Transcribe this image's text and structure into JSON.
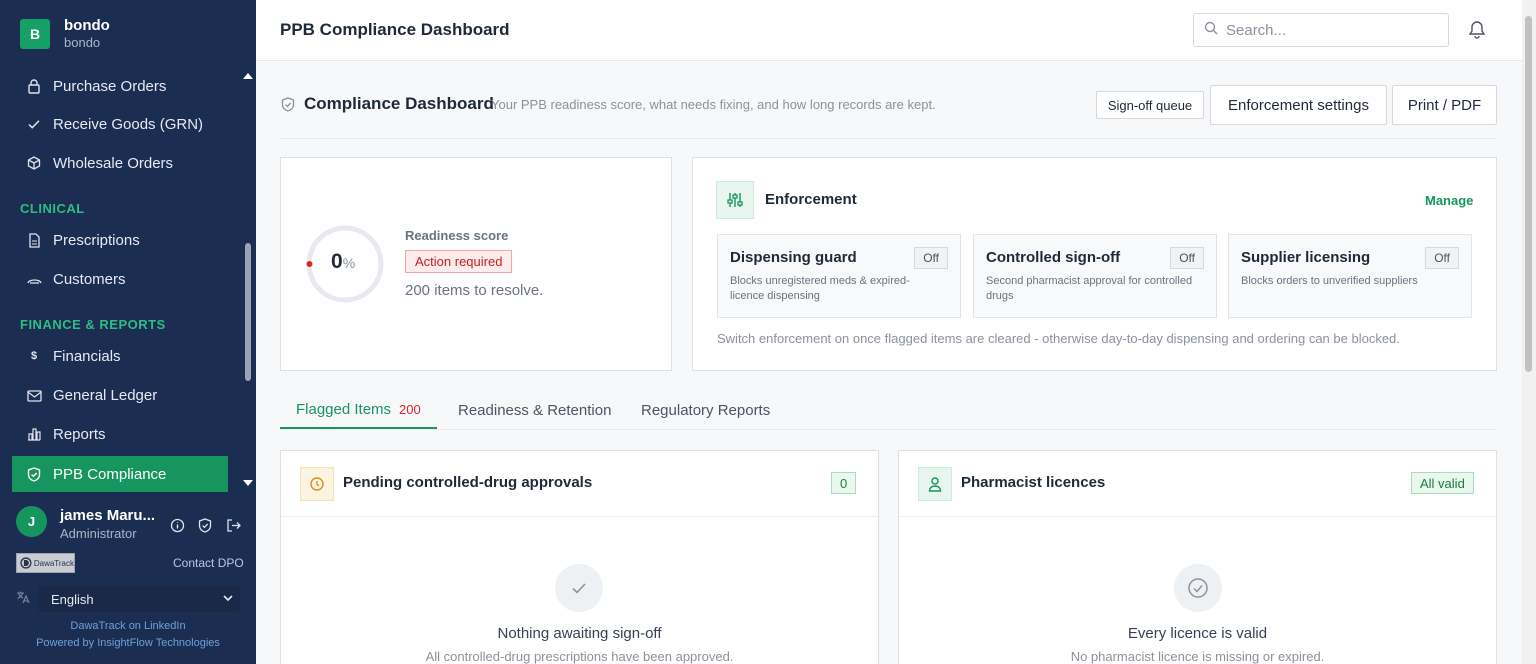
{
  "brand": {
    "logo_letter": "B",
    "name": "bondo",
    "sub": "bondo"
  },
  "sidebar": {
    "items": [
      {
        "label": "Purchase Orders",
        "icon": "lock-icon"
      },
      {
        "label": "Receive Goods (GRN)",
        "icon": "check-icon"
      },
      {
        "label": "Wholesale Orders",
        "icon": "box-icon"
      },
      {
        "label": "Prescriptions",
        "icon": "document-icon"
      },
      {
        "label": "Customers",
        "icon": "customers-icon"
      },
      {
        "label": "Financials",
        "icon": "dollar-icon"
      },
      {
        "label": "General Ledger",
        "icon": "ledger-icon"
      },
      {
        "label": "Reports",
        "icon": "bar-chart-icon"
      },
      {
        "label": "PPB Compliance",
        "icon": "shield-icon",
        "active": true
      }
    ],
    "sections": {
      "clinical": "CLINICAL",
      "finance": "FINANCE & REPORTS"
    }
  },
  "user": {
    "initial": "J",
    "name": "james Maru...",
    "role": "Administrator"
  },
  "footer": {
    "logo_text": "DawaTrack",
    "contact": "Contact DPO",
    "language": "English",
    "linkedin": "DawaTrack on LinkedIn",
    "powered": "Powered by InsightFlow Technologies"
  },
  "topbar": {
    "title": "PPB Compliance Dashboard",
    "search_placeholder": "Search..."
  },
  "dashboard": {
    "title": "Compliance Dashboard",
    "subtitle": "Your PPB readiness score, what needs fixing, and how long records are kept.",
    "buttons": {
      "signoff": "Sign-off queue",
      "enforcement": "Enforcement settings",
      "print": "Print / PDF"
    }
  },
  "readiness": {
    "score": 0,
    "score_display": "0",
    "score_unit": "%",
    "label": "Readiness score",
    "status": "Action required",
    "resolve": "200 items to resolve."
  },
  "enforcement": {
    "title": "Enforcement",
    "manage": "Manage",
    "cards": [
      {
        "title": "Dispensing guard",
        "state": "Off",
        "desc": "Blocks unregistered meds & expired-licence dispensing"
      },
      {
        "title": "Controlled sign-off",
        "state": "Off",
        "desc": "Second pharmacist approval for controlled drugs"
      },
      {
        "title": "Supplier licensing",
        "state": "Off",
        "desc": "Blocks orders to unverified suppliers"
      }
    ],
    "note": "Switch enforcement on once flagged items are cleared - otherwise day-to-day dispensing and ordering can be blocked."
  },
  "tabs": [
    {
      "label": "Flagged Items",
      "count": "200",
      "active": true
    },
    {
      "label": "Readiness & Retention"
    },
    {
      "label": "Regulatory Reports"
    }
  ],
  "panels": {
    "left": {
      "title": "Pending controlled-drug approvals",
      "badge": "0",
      "empty_title": "Nothing awaiting sign-off",
      "empty_sub": "All controlled-drug prescriptions have been approved."
    },
    "right": {
      "title": "Pharmacist licences",
      "badge": "All valid",
      "empty_title": "Every licence is valid",
      "empty_sub": "No pharmacist licence is missing or expired."
    }
  },
  "colors": {
    "sidebar": "#1c2d52",
    "accent": "#16955f",
    "danger": "#dc2626"
  }
}
